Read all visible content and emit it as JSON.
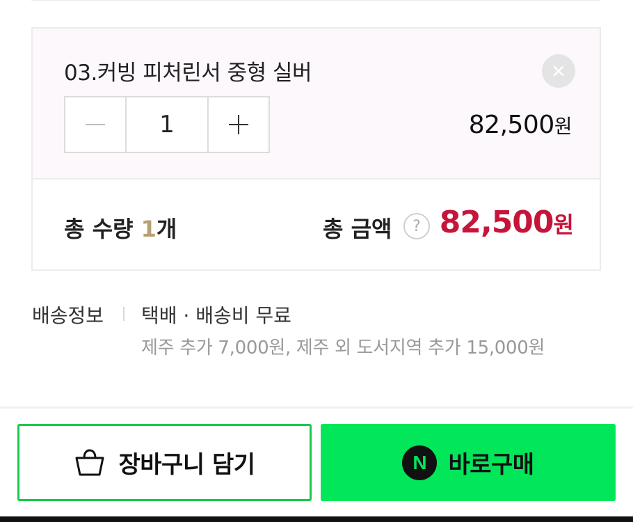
{
  "option": {
    "name": "03.커빙 피처린서 중형 실버",
    "quantity": "1",
    "price": "82,500",
    "price_unit": "원"
  },
  "total": {
    "qty_label": "총 수량 ",
    "qty_count": "1",
    "qty_unit": "개",
    "amount_label": "총 금액",
    "help_symbol": "?",
    "amount": "82,500",
    "amount_unit": "원"
  },
  "shipping": {
    "label": "배송정보",
    "main": "택배 · 배송비 무료",
    "extra": "제주 추가 7,000원, 제주 외 도서지역 추가 15,000원"
  },
  "actions": {
    "cart_label": "장바구니 담기",
    "buy_label": "바로구매",
    "buy_badge": "N"
  },
  "colors": {
    "accent_green": "#02e65a",
    "price_red": "#c6153a",
    "count_tan": "#b7a174"
  }
}
